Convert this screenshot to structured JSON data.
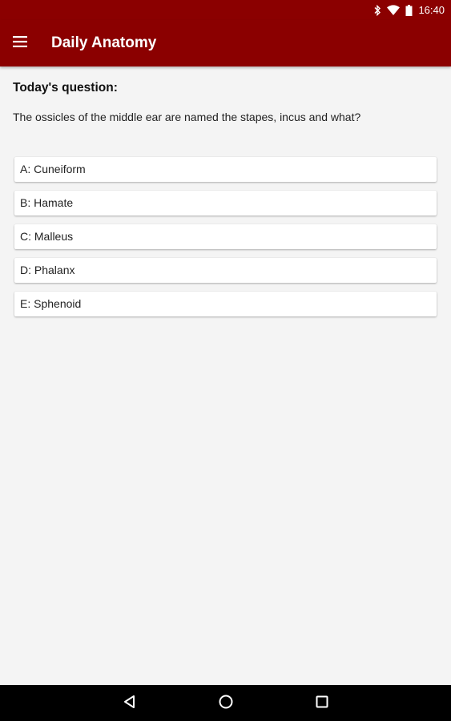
{
  "status_bar": {
    "time": "16:40",
    "icons": [
      "bluetooth-icon",
      "wifi-icon",
      "battery-icon"
    ]
  },
  "app_bar": {
    "title": "Daily Anatomy",
    "menu_icon": "hamburger-menu-icon",
    "background_color": "#8b0000"
  },
  "question": {
    "heading": "Today's question:",
    "text": "The ossicles of the middle ear are named the stapes, incus and what?"
  },
  "answers": [
    {
      "label": "A: Cuneiform"
    },
    {
      "label": "B: Hamate"
    },
    {
      "label": "C: Malleus"
    },
    {
      "label": "D: Phalanx"
    },
    {
      "label": "E: Sphenoid"
    }
  ],
  "nav_bar": {
    "buttons": [
      "back-icon",
      "home-icon",
      "recents-icon"
    ]
  }
}
